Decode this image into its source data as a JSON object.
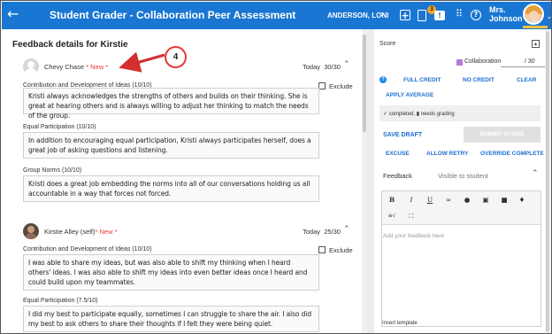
{
  "header": {
    "title": "Student Grader - Collaboration Peer Assessment",
    "student": "ANDERSON, LONI",
    "badge_count": "3",
    "user_line1": "Mrs.",
    "user_line2": "Johnson",
    "accent_color": "#1976d2"
  },
  "callout_number": "4",
  "main": {
    "title": "Feedback details for Kirstie",
    "entries": [
      {
        "author": "Chevy Chase",
        "marker": " * New *",
        "when": "Today",
        "score": "30/30",
        "criteria": [
          {
            "label": "Contribution and Development of Ideas (10/10)",
            "exclude": "Exclude",
            "comment": "Kristi always acknowledges the strengths of others and builds on their thinking. She is great at hearing others and is always willing to adjust her thinking to match the needs of the group."
          },
          {
            "label": "Equal Participation (10/10)",
            "comment": "In addition to encouraging equal participation, Kristi always participates herself, does a great job of asking questions and listening."
          },
          {
            "label": "Group Norms (10/10)",
            "comment": "Kristi does a great job embedding the norms into all of our conversations holding us all accountable in a way that forces not forced."
          }
        ]
      },
      {
        "author": "Kirstie Alley (self)",
        "marker": "* New *",
        "when": "Today",
        "score": "25/30",
        "criteria": [
          {
            "label": "Contribution and Development of Ideas (10/10)",
            "exclude": "Exclude",
            "comment": "I was able to share my ideas, but was also able to shift my thinking when I heard others' ideas. I was also able to shift my ideas into even better ideas once I heard and could build upon my teammates."
          },
          {
            "label": "Equal Participation (7.5/10)",
            "comment": "I did my best to participate equally, sometimes I can struggle to share the air. I also did my best to ask others to share their thoughts if I felt they were being quiet."
          }
        ]
      }
    ]
  },
  "sidebar": {
    "score_label": "Score",
    "criterion": "Collaboration",
    "criterion_max": "/ 30",
    "criterion_color": "#b47ad6",
    "full_credit": "FULL CREDIT",
    "no_credit": "NO CREDIT",
    "clear": "CLEAR",
    "apply_average": "APPLY AVERAGE",
    "status_completed": "completed,",
    "status_needs": "needs grading",
    "save_draft": "SAVE DRAFT",
    "submit_score": "SUBMIT SCORE",
    "excuse": "EXCUSE",
    "allow_retry": "ALLOW RETRY",
    "override_complete": "OVERRIDE COMPLETE",
    "feedback_label": "Feedback",
    "visibility": "Visible to student",
    "editor_placeholder": "Add your feedback here",
    "insert_template": "Insert template"
  }
}
